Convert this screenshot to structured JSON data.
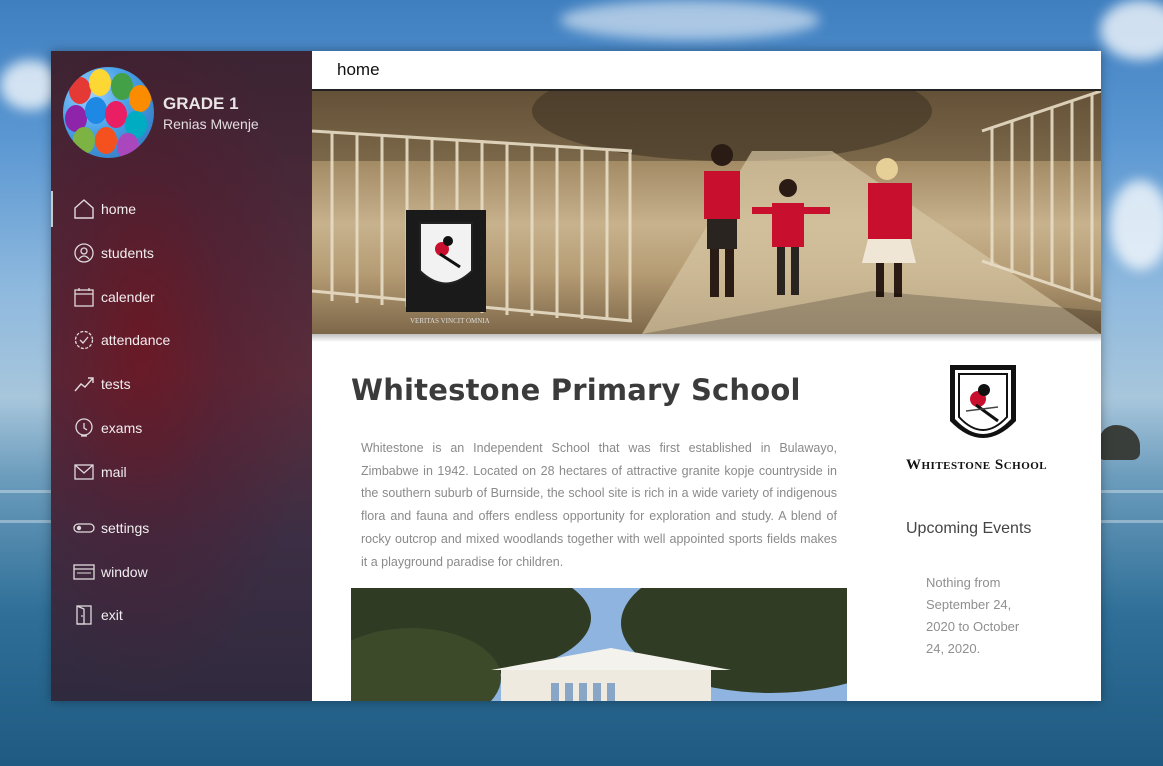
{
  "profile": {
    "grade": "GRADE 1",
    "name": "Renias Mwenje"
  },
  "nav": {
    "items": [
      {
        "label": "home",
        "icon": "home-icon",
        "active": true
      },
      {
        "label": "students",
        "icon": "students-icon"
      },
      {
        "label": "calender",
        "icon": "calendar-icon"
      },
      {
        "label": "attendance",
        "icon": "attendance-icon"
      },
      {
        "label": "tests",
        "icon": "trend-icon"
      },
      {
        "label": "exams",
        "icon": "exams-icon"
      },
      {
        "label": "mail",
        "icon": "mail-icon"
      },
      {
        "label": "settings",
        "icon": "toggle-icon"
      },
      {
        "label": "window",
        "icon": "window-icon"
      },
      {
        "label": "exit",
        "icon": "exit-icon"
      }
    ]
  },
  "header": {
    "title": "home"
  },
  "banner": {
    "crest_motto_left": "VERITAS",
    "crest_motto_right": "VINCIT",
    "crest_motto_bottom": "OMNIA"
  },
  "main": {
    "title": "Whitestone Primary School",
    "description": "Whitestone is an Independent School that was first established in Bulawayo, Zimbabwe in 1942. Located on 28 hectares of attractive granite kopje countryside in the southern suburb of Burnside, the school site is rich in a wide variety of indigenous flora and fauna and offers endless opportunity for exploration and study. A blend of rocky outcrop and mixed woodlands together with well appointed sports fields makes it a playground paradise for children."
  },
  "aside": {
    "logo_text": "Whitestone School",
    "events_title": "Upcoming Events",
    "events_text": "Nothing from September 24, 2020 to October 24, 2020."
  },
  "colors": {
    "sidebar_bg": "#4a2a3a",
    "accent": "#c8102e",
    "text_muted": "#8a8a8a"
  }
}
